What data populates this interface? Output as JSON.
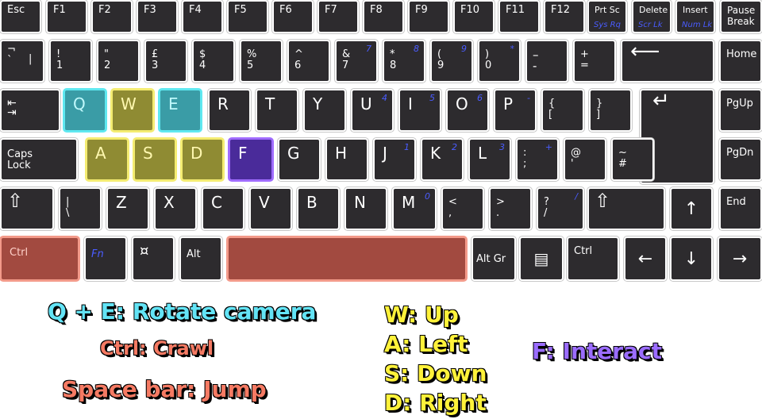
{
  "colors": {
    "key": "#2d2b2e",
    "cyan": "#3a9ca6",
    "yellow": "#8f8b33",
    "purple": "#4a2b9a",
    "red": "#a24a40",
    "pad_blue": "#4a5cff"
  },
  "row1": {
    "esc": "Esc",
    "f1": "F1",
    "f2": "F2",
    "f3": "F3",
    "f4": "F4",
    "f5": "F5",
    "f6": "F6",
    "f7": "F7",
    "f8": "F8",
    "f9": "F9",
    "f10": "F10",
    "f11": "F11",
    "f12": "F12",
    "prtsc": "Prt Sc",
    "sysrq": "Sys Rq",
    "delete": "Delete",
    "scrlk": "Scr Lk",
    "insert": "Insert",
    "numlk": "Num Lk",
    "pause": "Pause\nBreak"
  },
  "row2": {
    "backtick": "¬\n`",
    "backtick_alt": "|",
    "k1": "!\n1",
    "k2": "\"\n2",
    "k3": "£\n3",
    "k4": "$\n4",
    "k5": "%\n5",
    "k6": "^\n6",
    "k7": "&\n7",
    "k7_pad": "7",
    "k8": "*\n8",
    "k8_pad": "8",
    "k9": "(\n9",
    "k9_pad": "9",
    "k0": ")\n0",
    "k0_pad": "*",
    "minus": "–\n-",
    "plus": "+\n=",
    "home": "Home"
  },
  "row3": {
    "q": "Q",
    "w": "W",
    "e": "E",
    "r": "R",
    "t": "T",
    "y": "Y",
    "u": "U",
    "u_pad": "4",
    "i": "I",
    "i_pad": "5",
    "o": "O",
    "o_pad": "6",
    "p": "P",
    "p_pad": "-",
    "lbrace": "{\n[",
    "rbrace": "}\n]",
    "pgup": "PgUp"
  },
  "row4": {
    "caps": "Caps\nLock",
    "a": "A",
    "s": "S",
    "d": "D",
    "f": "F",
    "g": "G",
    "h": "H",
    "j": "J",
    "j_pad": "1",
    "k": "K",
    "k_pad": "2",
    "l": "L",
    "l_pad": "3",
    "colon": ":\n;",
    "colon_pad": "+",
    "at": "@\n'",
    "tilde": "~\n#",
    "pgdn": "PgDn"
  },
  "row5": {
    "pipe": "|\n\\",
    "z": "Z",
    "x": "X",
    "c": "C",
    "v": "V",
    "b": "B",
    "n": "N",
    "m": "M",
    "m_pad": "0",
    "lt": "<\n,",
    "gt": ">\n.",
    "qmark": "?\n/",
    "qmark_pad": "/",
    "end": "End"
  },
  "row6": {
    "ctrl_left": "Ctrl",
    "fn": "Fn",
    "alt": "Alt",
    "altgr": "Alt Gr",
    "ctrl_right": "Ctrl"
  },
  "arrows": {
    "up": "↑",
    "left": "←",
    "down": "↓",
    "right": "→",
    "tab": "⇤\n⇥",
    "backspace": "⟵",
    "enter": "↵",
    "shift": "⇧"
  },
  "legend": {
    "qe": "Q + E: Rotate camera",
    "ctrl": "Ctrl: Crawl",
    "space": "Space bar: Jump",
    "w": "W: Up",
    "a": "A: Left",
    "s": "S: Down",
    "d": "D: Right",
    "f": "F: Interact"
  }
}
